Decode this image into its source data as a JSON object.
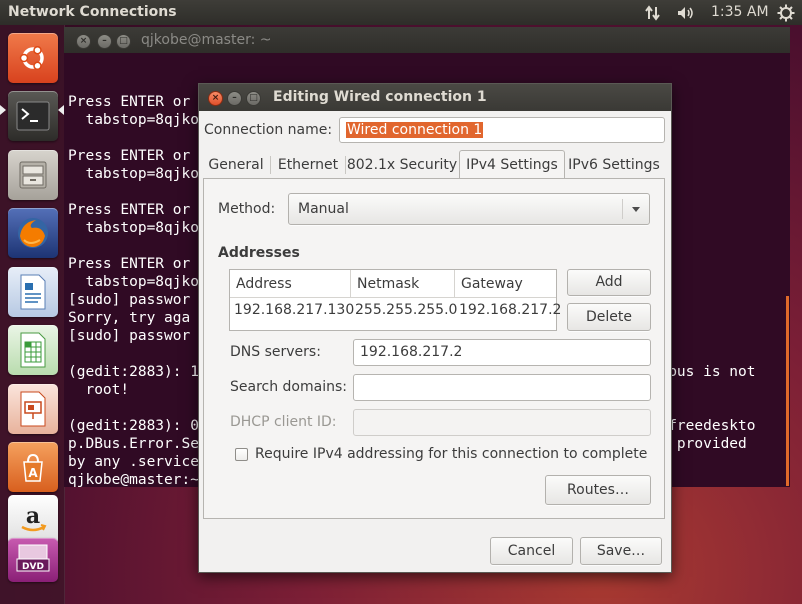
{
  "panel": {
    "app_title": "Network Connections",
    "clock": "1:35 AM",
    "icons": [
      "network-arrows-icon",
      "volume-icon",
      "gear-icon"
    ]
  },
  "launcher": {
    "items": [
      {
        "name": "ubuntu-dash-icon",
        "color": "#e05a2b"
      },
      {
        "name": "terminal-icon",
        "color": "#2c2c2c"
      },
      {
        "name": "files-icon",
        "color": "#9e9a91"
      },
      {
        "name": "firefox-icon",
        "color": "#e66000"
      },
      {
        "name": "writer-icon",
        "color": "#2a6fb0"
      },
      {
        "name": "calc-icon",
        "color": "#3a9b3a"
      },
      {
        "name": "impress-icon",
        "color": "#c84a1e"
      },
      {
        "name": "software-center-icon",
        "color": "#e57a2a"
      },
      {
        "name": "amazon-icon",
        "color": "#f2f2f2"
      },
      {
        "name": "dvd-icon",
        "color": "#a31f8a"
      }
    ]
  },
  "terminal": {
    "title": "qjkobe@master: ~",
    "lines": [
      "Press ENTER or",
      "  tabstop=8qjko",
      "",
      "Press ENTER or",
      "  tabstop=8qjko",
      "",
      "Press ENTER or",
      "  tabstop=8qjko",
      "",
      "Press ENTER or",
      "  tabstop=8qjko",
      "[sudo] passwor",
      "Sorry, try aga",
      "[sudo] passwor",
      "",
      "(gedit:2883): 1",
      "  root!",
      "",
      "(gedit:2883): 0",
      "p.DBus.Error.Se",
      "by any .service",
      "qjkobe@master:~"
    ],
    "overflow_lines": [
      {
        "text": "us/bus is not",
        "row": 15
      },
      {
        "text": "rg.freedeskto",
        "row": 18
      },
      {
        "text": "not provided",
        "row": 19
      }
    ]
  },
  "dialog": {
    "title": "Editing Wired connection 1",
    "connection_name_label": "Connection name:",
    "connection_name_value": "Wired connection 1",
    "tabs": [
      {
        "label": "General",
        "active": false
      },
      {
        "label": "Ethernet",
        "active": false
      },
      {
        "label": "802.1x Security",
        "active": false
      },
      {
        "label": "IPv4 Settings",
        "active": true
      },
      {
        "label": "IPv6 Settings",
        "active": false
      }
    ],
    "method_label": "Method:",
    "method_value": "Manual",
    "addresses_heading": "Addresses",
    "addresses_columns": [
      "Address",
      "Netmask",
      "Gateway"
    ],
    "addresses_rows": [
      [
        "192.168.217.130",
        "255.255.255.0",
        "192.168.217.2"
      ]
    ],
    "add_button": "Add",
    "delete_button": "Delete",
    "dns_label": "DNS servers:",
    "dns_value": "192.168.217.2",
    "search_domains_label": "Search domains:",
    "search_domains_value": "",
    "dhcp_client_id_label": "DHCP client ID:",
    "dhcp_client_id_value": "",
    "require_ipv4_label": "Require IPv4 addressing for this connection to complete",
    "require_ipv4_checked": false,
    "routes_button": "Routes…",
    "cancel_button": "Cancel",
    "save_button": "Save…"
  },
  "colors": {
    "accent_orange": "#e1662e",
    "terminal_bg": "#300a24",
    "panel_bg": "#3c3b37"
  }
}
